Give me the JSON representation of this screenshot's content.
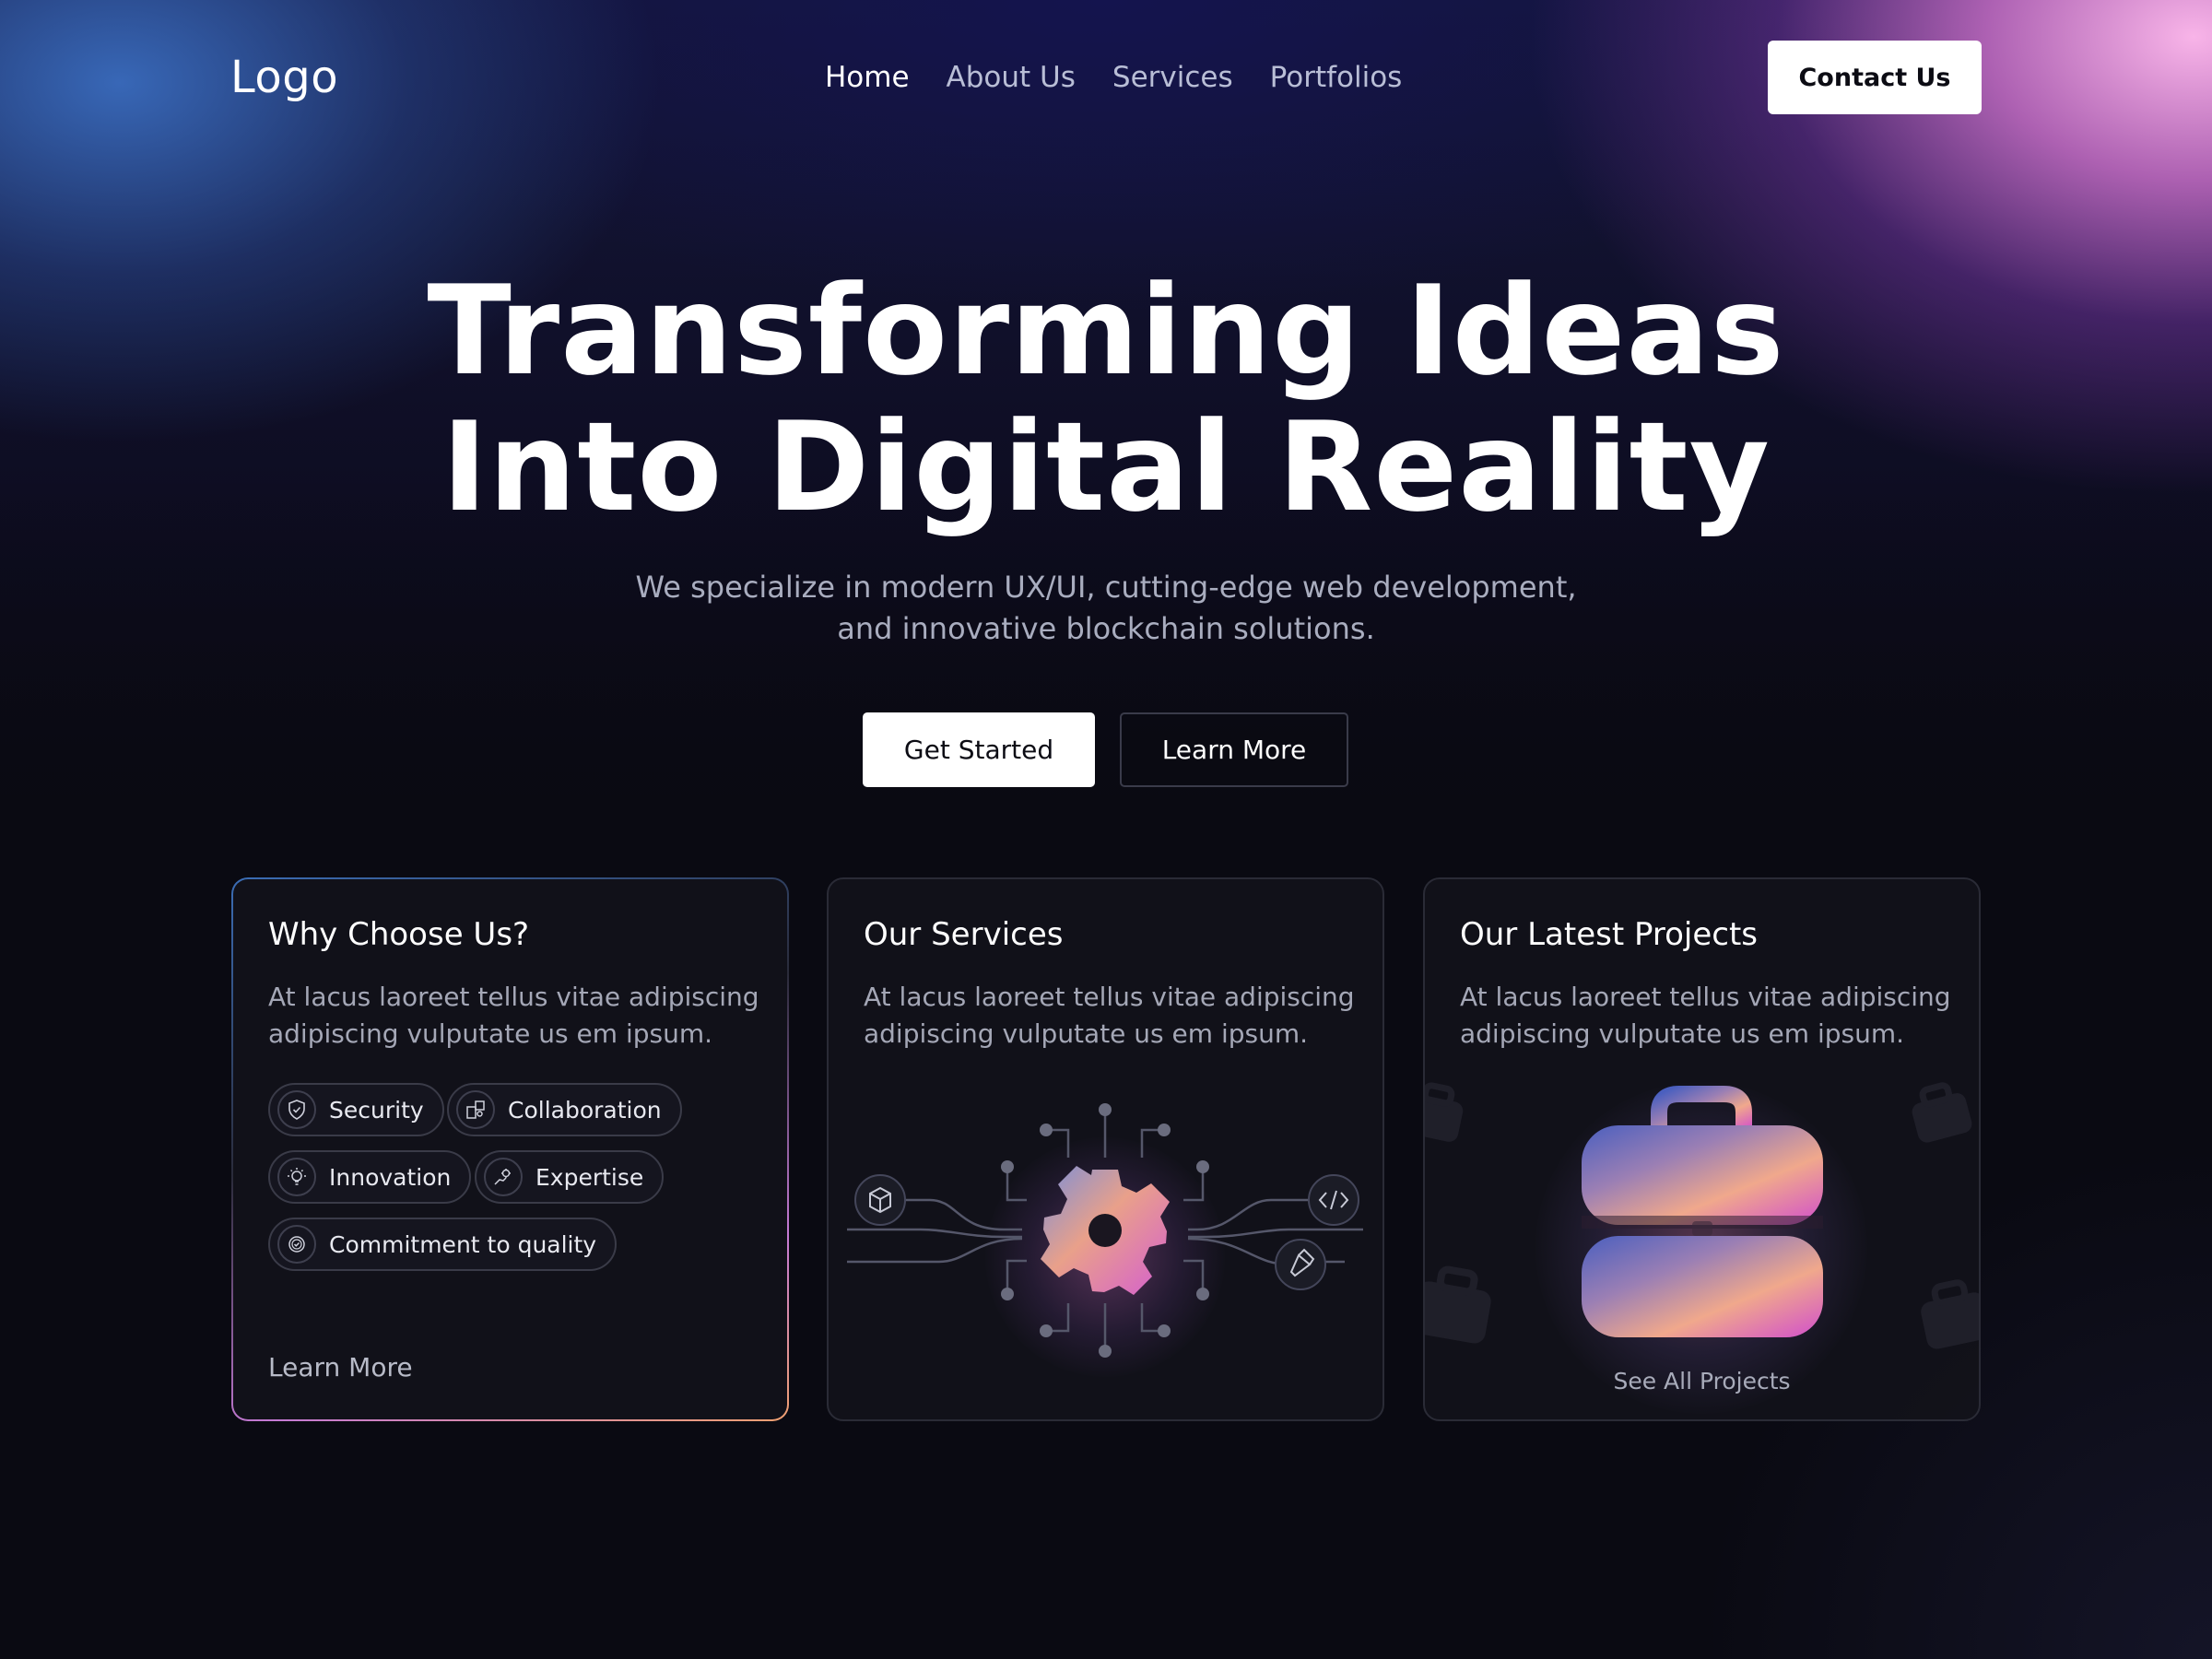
{
  "nav": {
    "logo": "Logo",
    "links": [
      "Home",
      "About Us",
      "Services",
      "Portfolios"
    ],
    "active_link": "Home",
    "contact_label": "Contact Us"
  },
  "hero": {
    "title_line1": "Transforming Ideas",
    "title_line2": "Into Digital Reality",
    "subtitle_line1": "We specialize in modern UX/UI, cutting-edge web development,",
    "subtitle_line2": "and innovative blockchain solutions.",
    "primary_label": "Get Started",
    "secondary_label": "Learn More"
  },
  "cards": [
    {
      "title": "Why Choose Us?",
      "text": "At lacus laoreet tellus vitae adipiscing adipiscing vulputate us em ipsum.",
      "pills": [
        {
          "label": "Security",
          "icon": "shield-icon"
        },
        {
          "label": "Collaboration",
          "icon": "puzzle-icon"
        },
        {
          "label": "Innovation",
          "icon": "lightbulb-icon"
        },
        {
          "label": "Expertise",
          "icon": "hand-gear-icon"
        },
        {
          "label": "Commitment to quality",
          "icon": "badge-check-icon"
        }
      ],
      "link": "Learn More"
    },
    {
      "title": "Our Services",
      "text": "At lacus laoreet tellus vitae adipiscing adipiscing vulputate us em ipsum.",
      "illustration": "gear-circuit",
      "side_icons": [
        "cube-icon",
        "code-icon",
        "pen-tool-icon"
      ]
    },
    {
      "title": "Our Latest Projects",
      "text": "At lacus laoreet tellus vitae adipiscing adipiscing vulputate us em ipsum.",
      "illustration": "briefcase",
      "link": "See All Projects"
    }
  ],
  "colors": {
    "accent_pink": "#e27ad4",
    "accent_blue": "#3b6db5",
    "accent_orange": "#f0a070",
    "background": "#0a0a12"
  }
}
